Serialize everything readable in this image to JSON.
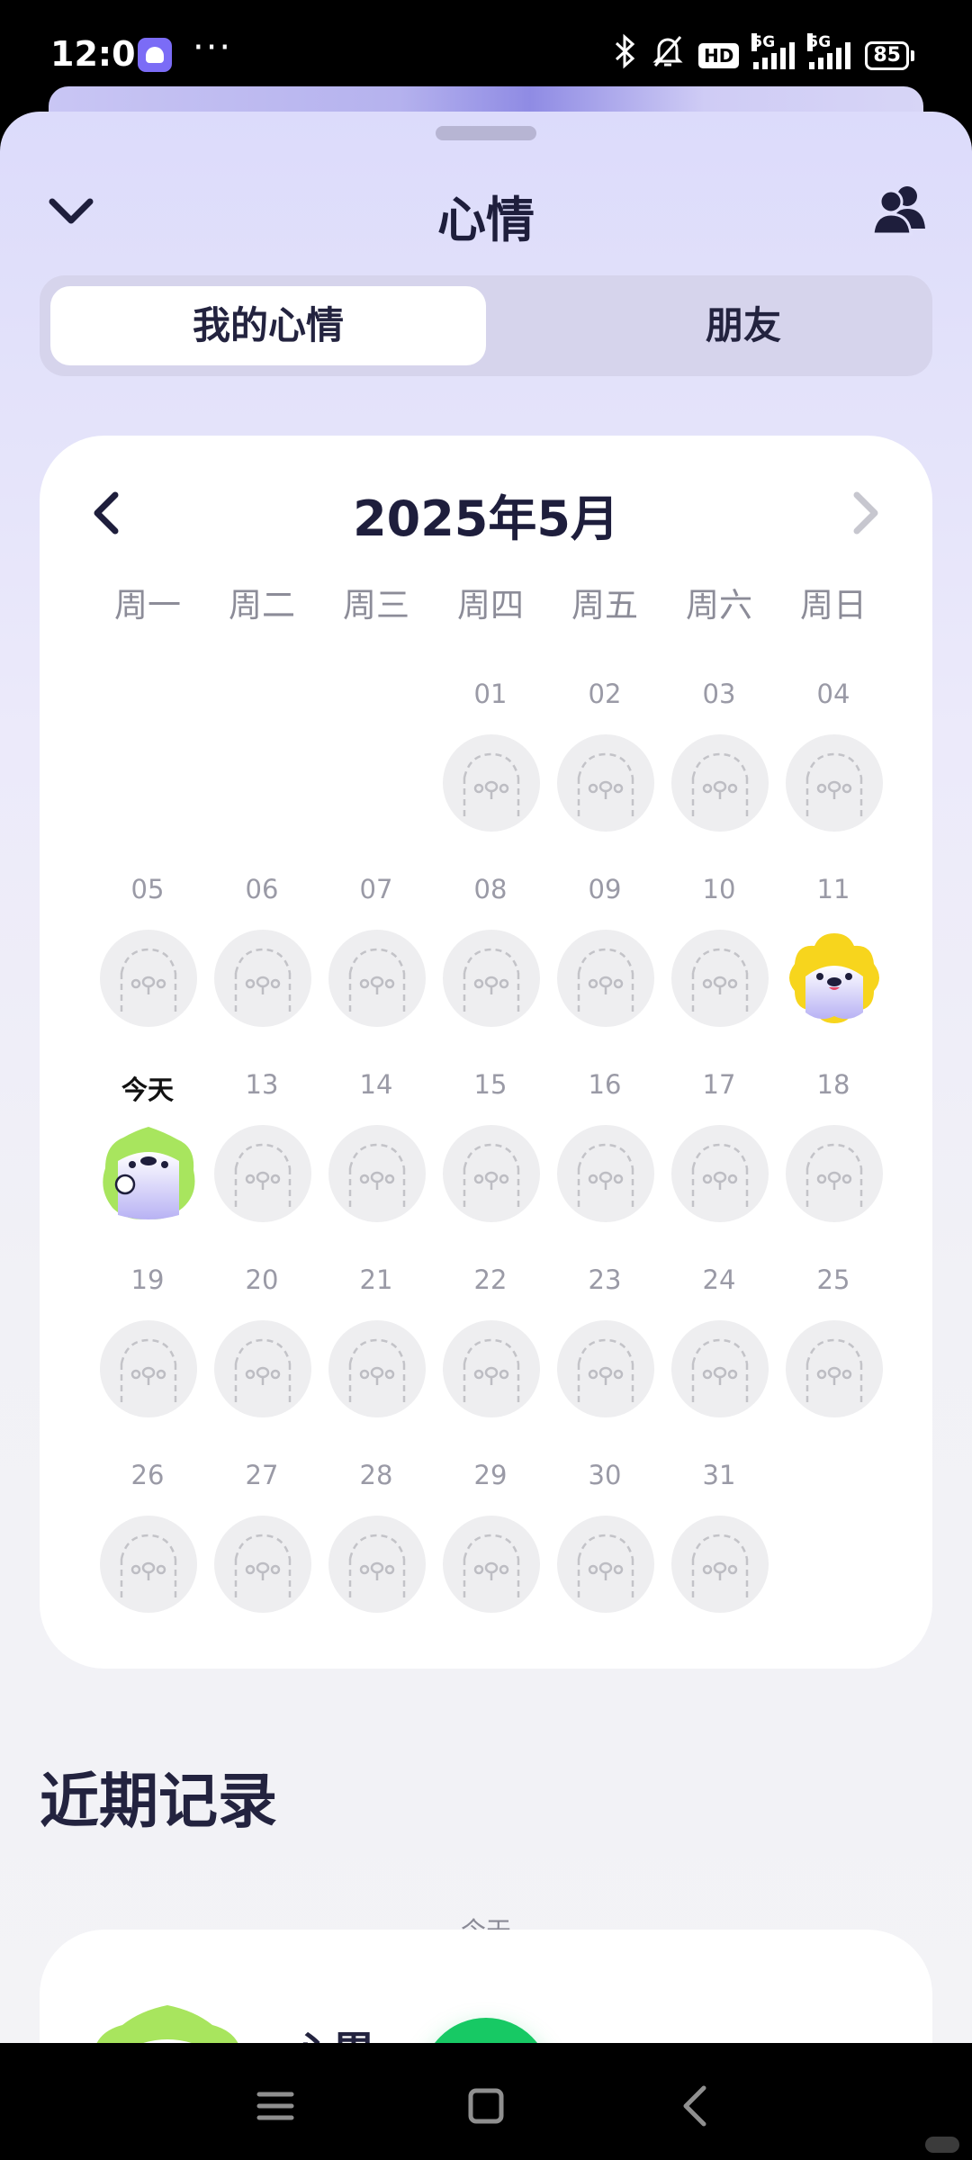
{
  "status_bar": {
    "time": "12:01",
    "more": "···",
    "hd_badge": "HD",
    "network_1": "5G",
    "network_2": "5G",
    "battery": "85",
    "icons": [
      "app-icon",
      "bluetooth-icon",
      "mute-bell-icon",
      "signal-icon",
      "battery-icon"
    ]
  },
  "sheet": {
    "title": "心情",
    "collapse_icon": "chevron-down-icon",
    "friends_icon": "people-icon"
  },
  "tabs": [
    {
      "label": "我的心情",
      "active": true
    },
    {
      "label": "朋友",
      "active": false
    }
  ],
  "calendar": {
    "month_label": "2025年5月",
    "prev_icon": "chevron-left-icon",
    "next_icon": "chevron-right-icon",
    "weekdays": [
      "周一",
      "周二",
      "周三",
      "周四",
      "周五",
      "周六",
      "周日"
    ],
    "start_weekday_index": 3,
    "days": [
      {
        "label": "01",
        "mood": "none"
      },
      {
        "label": "02",
        "mood": "none"
      },
      {
        "label": "03",
        "mood": "none"
      },
      {
        "label": "04",
        "mood": "none"
      },
      {
        "label": "05",
        "mood": "none"
      },
      {
        "label": "06",
        "mood": "none"
      },
      {
        "label": "07",
        "mood": "none"
      },
      {
        "label": "08",
        "mood": "none"
      },
      {
        "label": "09",
        "mood": "none"
      },
      {
        "label": "10",
        "mood": "none"
      },
      {
        "label": "11",
        "mood": "happy-yellow"
      },
      {
        "label": "今天",
        "mood": "tired-green",
        "today": true
      },
      {
        "label": "13",
        "mood": "none"
      },
      {
        "label": "14",
        "mood": "none"
      },
      {
        "label": "15",
        "mood": "none"
      },
      {
        "label": "16",
        "mood": "none"
      },
      {
        "label": "17",
        "mood": "none"
      },
      {
        "label": "18",
        "mood": "none"
      },
      {
        "label": "19",
        "mood": "none"
      },
      {
        "label": "20",
        "mood": "none"
      },
      {
        "label": "21",
        "mood": "none"
      },
      {
        "label": "22",
        "mood": "none"
      },
      {
        "label": "23",
        "mood": "none"
      },
      {
        "label": "24",
        "mood": "none"
      },
      {
        "label": "25",
        "mood": "none"
      },
      {
        "label": "26",
        "mood": "none"
      },
      {
        "label": "27",
        "mood": "none"
      },
      {
        "label": "28",
        "mood": "none"
      },
      {
        "label": "29",
        "mood": "none"
      },
      {
        "label": "30",
        "mood": "none"
      },
      {
        "label": "31",
        "mood": "none"
      }
    ]
  },
  "recent": {
    "title": "近期记录",
    "today_label": "今天",
    "record": {
      "mood_label": "心累",
      "mood": "tired-green"
    }
  },
  "fab": {
    "icon": "plus-icon"
  },
  "nav": {
    "icons": [
      "menu-icon",
      "home-icon",
      "back-icon"
    ]
  },
  "colors": {
    "accent_green": "#17c964",
    "mood_yellow": "#f7d51d",
    "mood_green": "#9fe05c",
    "mood_lavender": "#b8b2f4",
    "title_text": "#1e1e3c"
  }
}
